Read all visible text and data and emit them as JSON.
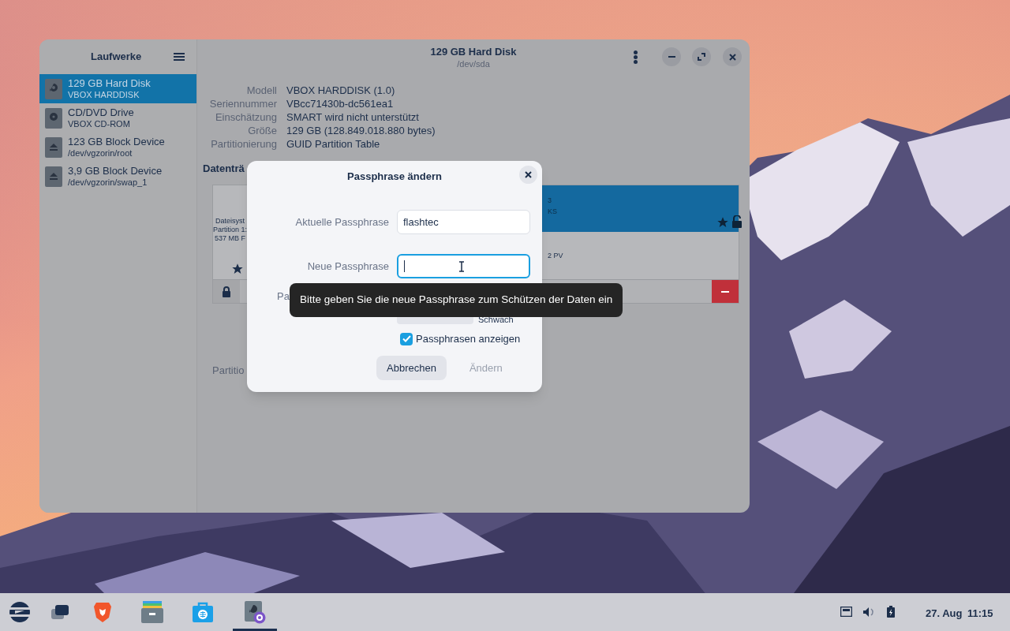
{
  "window": {
    "sidebar_title": "Laufwerke",
    "title": "129 GB Hard Disk",
    "subtitle": "/dev/sda"
  },
  "drives": [
    {
      "name": "129 GB Hard Disk",
      "detail": "VBOX HARDDISK",
      "kind": "disk",
      "selected": true
    },
    {
      "name": "CD/DVD Drive",
      "detail": "VBOX CD-ROM",
      "kind": "optical",
      "selected": false
    },
    {
      "name": "123 GB Block Device",
      "detail": "/dev/vgzorin/root",
      "kind": "block",
      "selected": false
    },
    {
      "name": "3,9 GB Block Device",
      "detail": "/dev/vgzorin/swap_1",
      "kind": "block",
      "selected": false
    }
  ],
  "properties": [
    {
      "label": "Modell",
      "value": "VBOX HARDDISK (1.0)"
    },
    {
      "label": "Seriennummer",
      "value": "VBcc71430b-dc561ea1"
    },
    {
      "label": "Einschätzung",
      "value": "SMART wird nicht unterstützt"
    },
    {
      "label": "Größe",
      "value": "129 GB (128.849.018.880 bytes)"
    },
    {
      "label": "Partitionierung",
      "value": "GUID Partition Table"
    }
  ],
  "volumes": {
    "heading": "Datenträ",
    "partition_1": [
      "Dateisyst",
      "Partition 1:",
      "537 MB F"
    ],
    "partition_2": [
      "3",
      "KS"
    ],
    "partition_3": "2 PV",
    "below_label": "Partitio"
  },
  "dialog": {
    "title": "Passphrase ändern",
    "fields": [
      {
        "label": "Aktuelle Passphrase",
        "value": "flashtec",
        "focused": false
      },
      {
        "label": "Neue Passphrase",
        "focused": true
      },
      {
        "label": "Pa",
        "covered": true
      }
    ],
    "strength": {
      "level": 0,
      "label": "Schwach"
    },
    "show_passphrases": {
      "label": "Passphrasen anzeigen",
      "checked": true
    },
    "buttons": [
      {
        "label": "Abbrechen",
        "disabled": false
      },
      {
        "label": "Ändern",
        "disabled": true
      }
    ]
  },
  "tooltip": "Bitte geben Sie die neue Passphrase zum Schützen der Daten ein",
  "taskbar": {
    "apps": [
      {
        "kind": "menu",
        "selected": false
      },
      {
        "kind": "windows",
        "selected": false
      },
      {
        "kind": "browser",
        "selected": false
      },
      {
        "kind": "files",
        "selected": false
      },
      {
        "kind": "store",
        "selected": false
      },
      {
        "kind": "disks",
        "selected": true
      }
    ],
    "date": "27. Aug",
    "time": "11:15"
  }
}
